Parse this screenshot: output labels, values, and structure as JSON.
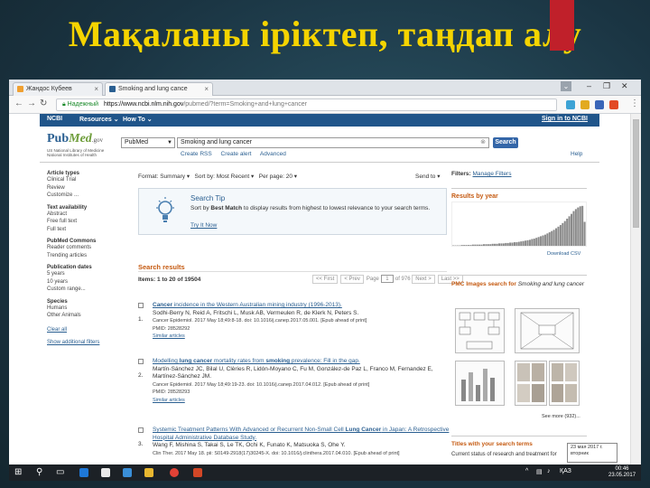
{
  "slide": {
    "title": "Мақаланы іріктеп, таңдап алу",
    "accent_color": "#c0202a",
    "title_color": "#f5d400"
  },
  "browser": {
    "tabs": [
      {
        "label": "Жандос Күбеев",
        "icon": "person-icon"
      },
      {
        "label": "Smoking and lung cance",
        "icon": "pubmed-icon"
      }
    ],
    "user_icon_label": "⌄",
    "url_secure_label": "Надежный",
    "url_host": "https://www.ncbi.nlm.nih.gov",
    "url_rest": "/pubmed/?term=Smoking+and+lung+cancer"
  },
  "ncbi": {
    "logo": "NCBI",
    "resources": "Resources ⌄",
    "howto": "How To ⌄",
    "signin": "Sign in to NCBI",
    "pubmed_logo_1": "Pub",
    "pubmed_logo_2": "Med",
    "pubmed_logo_3": ".gov",
    "pubmed_sub": "US National Library of Medicine National Institutes of Health",
    "db_value": "PubMed",
    "query": "Smoking and lung cancer",
    "search_label": "Search",
    "create_rss": "Create RSS",
    "create_alert": "Create alert",
    "advanced": "Advanced",
    "help": "Help"
  },
  "sidebar": {
    "groups": [
      {
        "heading": "Article types",
        "items": [
          "Clinical Trial",
          "Review",
          "Customize ..."
        ]
      },
      {
        "heading": "Text availability",
        "items": [
          "Abstract",
          "Free full text",
          "Full text"
        ]
      },
      {
        "heading": "PubMed Commons",
        "items": [
          "Reader comments",
          "Trending articles"
        ]
      },
      {
        "heading": "Publication dates",
        "items": [
          "5 years",
          "10 years",
          "Custom range..."
        ]
      },
      {
        "heading": "Species",
        "items": [
          "Humans",
          "Other Animals"
        ]
      }
    ],
    "clear_all": "Clear all",
    "show_additional": "Show additional filters"
  },
  "toolbar": {
    "format_label": "Format:",
    "format_value": "Summary ▾",
    "sort_label": "Sort by:",
    "sort_value": "Most Recent ▾",
    "perpage_label": "Per page:",
    "perpage_value": "20 ▾",
    "send_to": "Send to ▾",
    "filters_label": "Filters:",
    "manage_filters": "Manage Filters"
  },
  "tip": {
    "title": "Search Tip",
    "text_1": "Sort by ",
    "text_bold": "Best Match",
    "text_2": " to display results from highest to lowest relevance to your search terms.",
    "link": "Try It Now"
  },
  "results": {
    "heading": "Search results",
    "items_label": "Items: 1 to 20 of 19504",
    "pager_first": "<< First",
    "pager_prev": "< Prev",
    "pager_page_label": "Page",
    "pager_page": "1",
    "pager_of": "of 976",
    "pager_next": "Next >",
    "pager_last": "Last >>",
    "list": [
      {
        "num": "1.",
        "title_1": "Cancer",
        "title_2": " incidence in the Western Australian mining industry (1996-2013).",
        "authors": "Sodhi-Berry N, Reid A, Fritschi L, Musk AB, Vermeulen R, de Klerk N, Peters S.",
        "journal": "Cancer Epidemiol. 2017 May 18;49:8-18. doi: 10.1016/j.canep.2017.05.001. [Epub ahead of print]",
        "pmid": "PMID: 28528292",
        "similar": "Similar articles"
      },
      {
        "num": "2.",
        "title_1": "Modelling ",
        "title_hl1": "lung cancer",
        "title_2": " mortality rates from ",
        "title_hl2": "smoking",
        "title_3": " prevalence: Fill in the gap.",
        "authors": "Martín-Sánchez JC, Bilal U, Clèries R, Lidón-Moyano C, Fu M, González-de Paz L, Franco M, Fernandez E, Martínez-Sánchez JM.",
        "journal": "Cancer Epidemiol. 2017 May 18;49:19-23. doi: 10.1016/j.canep.2017.04.012. [Epub ahead of print]",
        "pmid": "PMID: 28528293",
        "similar": "Similar articles"
      },
      {
        "num": "3.",
        "title_1": "Systemic Treatment Patterns With Advanced or Recurrent Non-Small Cell ",
        "title_hl1": "Lung Cancer",
        "title_2": " in Japan: A Retrospective Hospital Administrative Database Study.",
        "authors": "Wang F, Mishina S, Takai S, Le TK, Ochi K, Funato K, Matsuoka S, Ohe Y.",
        "journal": "Clin Ther. 2017 May 18. pii: S0149-2918(17)30245-X. doi: 10.1016/j.clinthera.2017.04.010. [Epub ahead of print]"
      }
    ]
  },
  "right": {
    "results_by_year": "Results by year",
    "download_csv": "Download CSV",
    "pmc_title": "PMC Images search for ",
    "pmc_query": "Smoking and lung cancer",
    "see_more": "See more (932)...",
    "titles_heading": "Titles with your search terms",
    "titles_line": "Current status of research and treatment for"
  },
  "tooltip": {
    "line1": "23 мая 2017 г.",
    "line2": "вторник"
  },
  "taskbar": {
    "lang": "ҚАЗ",
    "time": "00:46",
    "date": "23.05.2017"
  },
  "chart_data": {
    "type": "bar",
    "title": "Results by year",
    "values": [
      1,
      1,
      1,
      1,
      2,
      2,
      2,
      2,
      2,
      3,
      3,
      3,
      3,
      3,
      4,
      4,
      4,
      4,
      5,
      5,
      5,
      6,
      6,
      6,
      7,
      7,
      8,
      8,
      9,
      9,
      10,
      11,
      12,
      13,
      14,
      15,
      17,
      18,
      20,
      22,
      24,
      26,
      28,
      31,
      34,
      37,
      40,
      44,
      48,
      52,
      57,
      62,
      68,
      74,
      80,
      87,
      92,
      96,
      99,
      100,
      60
    ]
  }
}
